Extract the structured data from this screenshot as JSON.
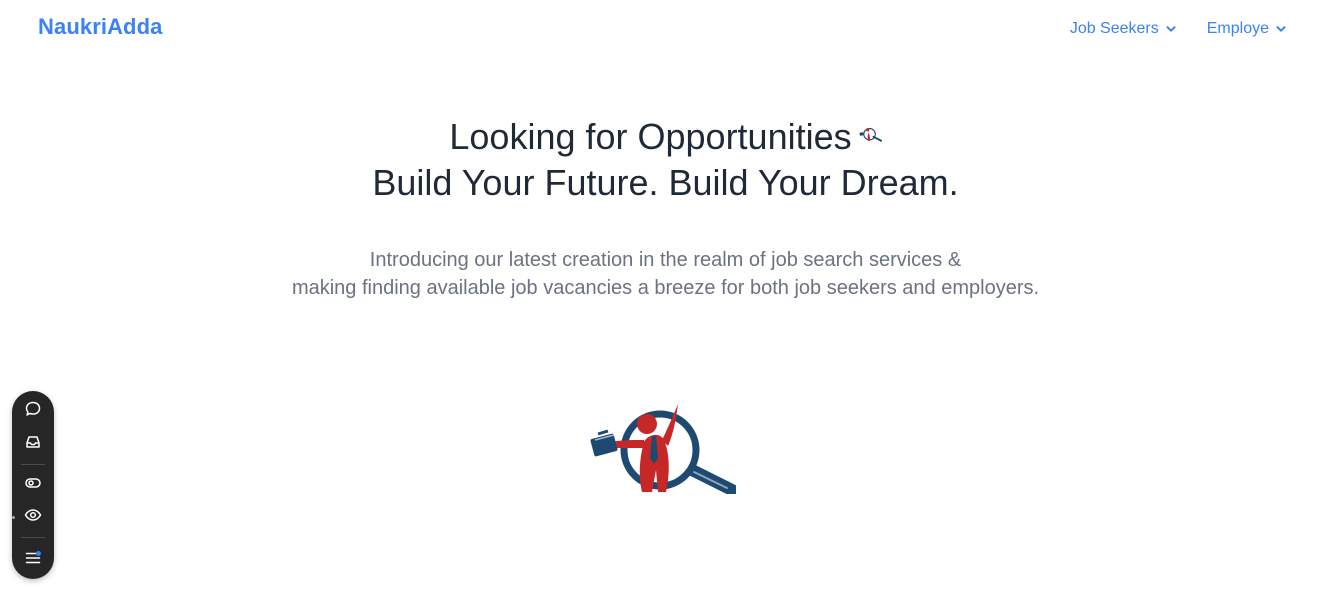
{
  "brand": {
    "name": "NaukriAdda",
    "color": "#3b82f6"
  },
  "nav": {
    "items": [
      {
        "label": "Job Seekers",
        "icon": "chevron-down-icon"
      },
      {
        "label": "Employe",
        "icon": "chevron-down-icon"
      }
    ]
  },
  "hero": {
    "headline_line1": "Looking for Opportunities",
    "headline_line2": "Build Your Future. Build Your Dream.",
    "subtitle_line1": "Introducing our latest creation in the realm of job search services &",
    "subtitle_line2": "making finding available job vacancies a breeze for both job seekers and employers."
  },
  "logo": {
    "icon": "job-search-logo-icon",
    "colors": {
      "red": "#c62828",
      "navy": "#1e4a72"
    }
  },
  "toolbar": {
    "items": [
      {
        "icon": "comment-icon"
      },
      {
        "icon": "inbox-icon"
      },
      {
        "icon": "toggle-view-icon"
      },
      {
        "icon": "eye-icon"
      },
      {
        "icon": "menu-icon"
      }
    ]
  }
}
